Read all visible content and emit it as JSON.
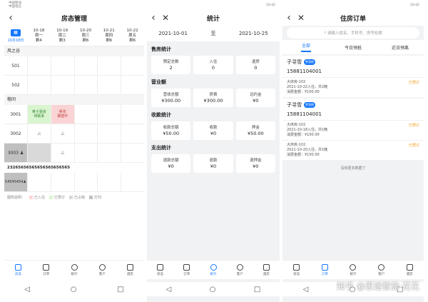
{
  "p1": {
    "status": {
      "carrier1": "中国移动",
      "carrier2": "中国电信"
    },
    "title": "房态管理",
    "today": "10月18日",
    "dates": [
      {
        "d": "10-18",
        "w": "周一",
        "left": "剩4"
      },
      {
        "d": "10-19",
        "w": "周二",
        "left": "剩3"
      },
      {
        "d": "10-20",
        "w": "周三",
        "left": "剩6"
      },
      {
        "d": "10-21",
        "w": "周四",
        "left": "剩6"
      },
      {
        "d": "10-22",
        "w": "周五",
        "left": "剩6"
      }
    ],
    "section1": "风之谷",
    "rooms1": [
      "501",
      "502"
    ],
    "section2": "榕间",
    "room3001": "3001",
    "c3001a": [
      "黄子豪房",
      "待联系"
    ],
    "c3001b": [
      "吴花",
      "期望中"
    ],
    "room3002": "3002",
    "cleanIcon": "占",
    "room3003": "3003",
    "longnum": "23265656565656565656565",
    "room5454": "54545454",
    "legend": {
      "title": "图例说明：",
      "a": "已入住",
      "b": "已预订",
      "c": "已占锁",
      "d": "打扫"
    },
    "colors": {
      "checked": "#fad4d4",
      "booked": "#d9f5d0",
      "locked": "#d9d9d9",
      "clean": "#bfbfbf"
    }
  },
  "tabs": [
    {
      "label": "房态",
      "icon": "house-icon"
    },
    {
      "label": "订单",
      "icon": "order-icon"
    },
    {
      "label": "统计",
      "icon": "chart-icon"
    },
    {
      "label": "客户",
      "icon": "user-icon"
    },
    {
      "label": "酒店",
      "icon": "hotel-icon"
    }
  ],
  "nav": {
    "back": "◁",
    "home": "○",
    "recent": "□"
  },
  "p2": {
    "time": "10:42",
    "title": "统计",
    "start": "2021-10-01",
    "to": "至",
    "end": "2021-10-25",
    "s1": "售房统计",
    "s1cards": [
      {
        "l": "预定总数",
        "v": "2"
      },
      {
        "l": "入住",
        "v": "0"
      },
      {
        "l": "退房",
        "v": "0"
      }
    ],
    "s2": "营业额",
    "s2cards": [
      {
        "l": "营收总额",
        "v": "¥300.00"
      },
      {
        "l": "房费",
        "v": "¥300.00"
      },
      {
        "l": "远约金",
        "v": "¥0"
      }
    ],
    "s3": "收款统计",
    "s3cards": [
      {
        "l": "收款总额",
        "v": "¥50.00"
      },
      {
        "l": "收款",
        "v": "¥0"
      },
      {
        "l": "押金",
        "v": "¥50.00"
      }
    ],
    "s4": "支出统计",
    "s4cards": [
      {
        "l": "退款总额",
        "v": "¥0"
      },
      {
        "l": "退款",
        "v": "¥0"
      },
      {
        "l": "退押金",
        "v": "¥0"
      }
    ]
  },
  "p3": {
    "time": "10:42",
    "title": "住房订单",
    "placeholder": "请输入姓名、手机号、房号检索",
    "tabs": [
      "全部",
      "今日预抵",
      "近日预离"
    ],
    "g1": {
      "name": "子寻雪",
      "badge": "梦游侠",
      "phone": "15881104001"
    },
    "o1": {
      "room": "大床房-102",
      "date": "2021-10-22入住，共2晚",
      "amt": "消费金额：¥100.00",
      "status": "已预订"
    },
    "g2": {
      "name": "子寻雪",
      "badge": "梦游侠",
      "phone": "15881104001"
    },
    "o2": {
      "room": "大床房-102",
      "date": "2021-10-18入住，共1晚",
      "amt": "消费金额：¥100.00",
      "status": "已预订"
    },
    "o3": {
      "room": "大床房-102",
      "date": "2021-10-20入住，共1晚",
      "amt": "消费金额：¥100.00",
      "status": "已预订"
    },
    "nomore": "没有更多数据了",
    "watermark": "知乎 @思途智旅-花花"
  }
}
